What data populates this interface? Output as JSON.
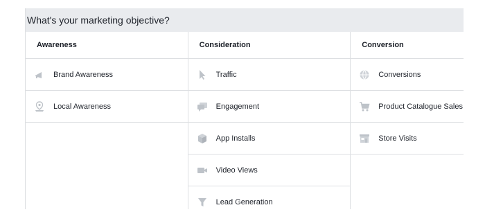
{
  "header": {
    "title": "What's your marketing objective?"
  },
  "columns": [
    {
      "title": "Awareness",
      "items": [
        {
          "label": "Brand Awareness",
          "icon": "megaphone-icon"
        },
        {
          "label": "Local Awareness",
          "icon": "location-pin-icon"
        }
      ]
    },
    {
      "title": "Consideration",
      "items": [
        {
          "label": "Traffic",
          "icon": "cursor-icon"
        },
        {
          "label": "Engagement",
          "icon": "chat-bubbles-icon"
        },
        {
          "label": "App Installs",
          "icon": "cube-icon"
        },
        {
          "label": "Video Views",
          "icon": "video-camera-icon"
        },
        {
          "label": "Lead Generation",
          "icon": "funnel-icon"
        }
      ]
    },
    {
      "title": "Conversion",
      "items": [
        {
          "label": "Conversions",
          "icon": "globe-icon"
        },
        {
          "label": "Product Catalogue Sales",
          "icon": "shopping-cart-icon"
        },
        {
          "label": "Store Visits",
          "icon": "storefront-icon"
        }
      ]
    }
  ],
  "colors": {
    "icon": "#bec3c9",
    "border": "#dddfe2",
    "header_bg": "#e9ebee",
    "text": "#1d2129"
  }
}
